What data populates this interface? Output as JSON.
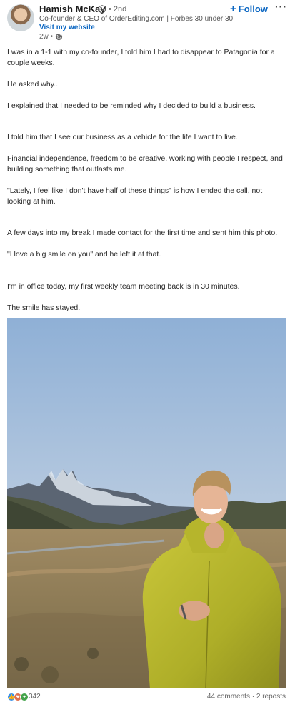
{
  "author": {
    "name": "Hamish McKay",
    "degree": "• 2nd",
    "headline": "Co-founder & CEO of OrderEditing.com | Forbes 30 under 30",
    "website_link": "Visit my website",
    "post_age": "2w •"
  },
  "actions": {
    "follow_label": "Follow",
    "follow_plus": "+",
    "more_label": "···"
  },
  "post": {
    "paragraphs": [
      "I was in a 1-1 with my co-founder, I told him I had to disappear to Patagonia for a couple weeks.",
      "He asked why...",
      "I explained that I needed to be reminded why I decided to build a business.",
      "I told him that I see our business as a vehicle for the life I want to live.",
      "Financial independence, freedom to be creative, working with people I respect, and building something that outlasts me.",
      "\"Lately, I feel like I don't have half of these things\" is how I ended the call, not looking at him.",
      "A few days into my break I made contact for the first time and sent him this photo.",
      "\"I love a big smile on you\" and he left it at that.",
      "I'm in office today, my first weekly team meeting back is in 30 minutes.",
      "The smile has stayed."
    ]
  },
  "social": {
    "reaction_count": "342",
    "comments": "44 comments",
    "separator": "·",
    "reposts": "2 reposts"
  },
  "colors": {
    "link_blue": "#0a66c2",
    "jacket_yellow": "#b9b82e"
  },
  "icons": {
    "verified": "shield-check-icon",
    "visibility": "globe-icon",
    "reactions": [
      "like-icon",
      "love-icon",
      "celebrate-icon"
    ]
  }
}
